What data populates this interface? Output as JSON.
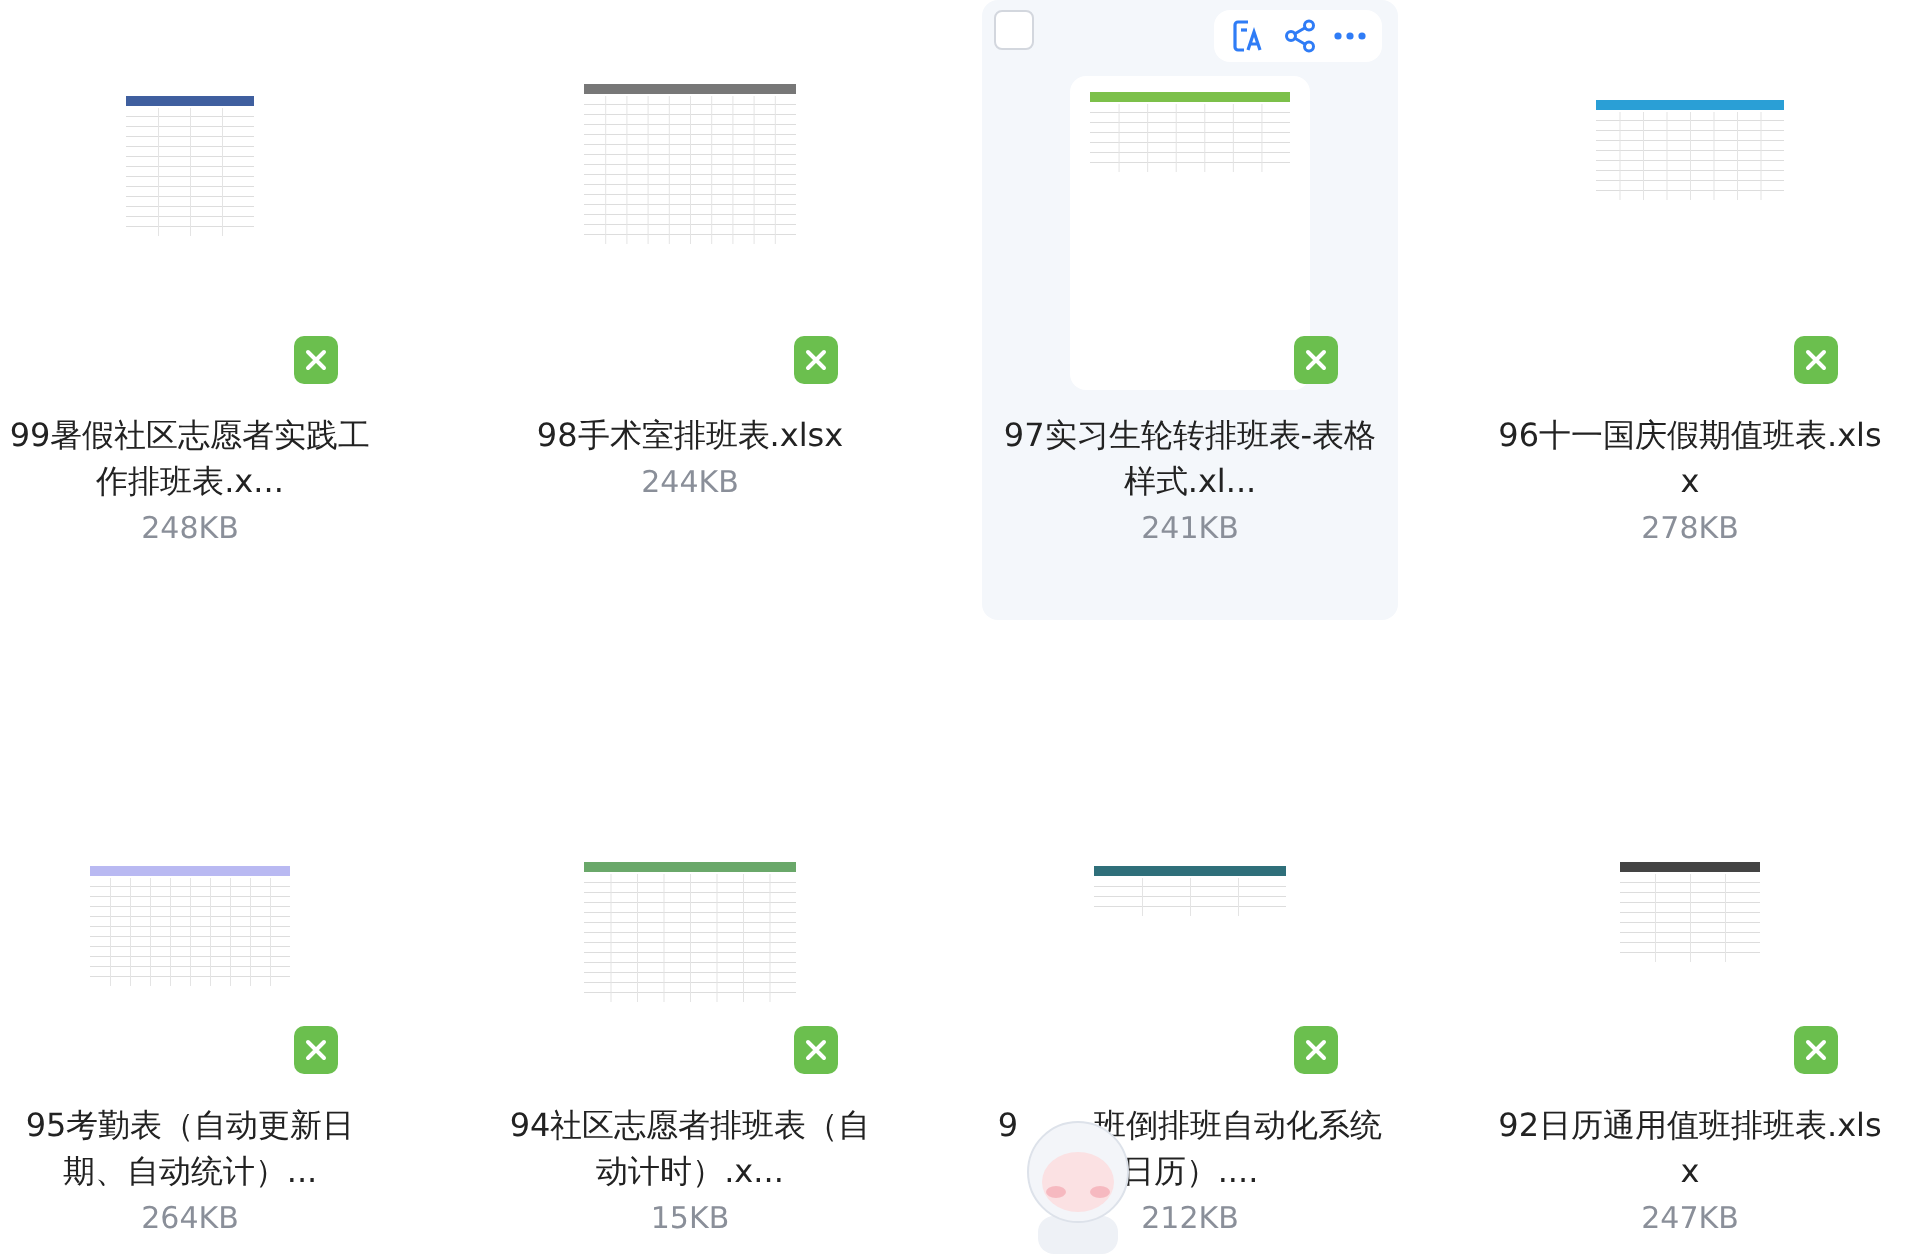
{
  "files": [
    {
      "title_lines": [
        [
          "99暑假社区志愿者实践工"
        ],
        [
          "作排班表.x..."
        ]
      ],
      "size": "248KB",
      "hovered": false
    },
    {
      "title_lines": [
        [
          "98手术室排班表.xlsx"
        ]
      ],
      "size": "244KB",
      "hovered": false
    },
    {
      "title_lines": [
        [
          "97实习生轮转排班表-表格"
        ],
        [
          "样式.xl..."
        ]
      ],
      "size": "241KB",
      "hovered": true,
      "checked": false
    },
    {
      "title_lines": [
        [
          "96十一国庆假期值班表.xls"
        ],
        [
          "x"
        ]
      ],
      "size": "278KB",
      "hovered": false
    },
    {
      "title_lines": [
        [
          "95考勤表（自动更新日"
        ],
        [
          "期、自动统计）..."
        ]
      ],
      "size": "264KB",
      "hovered": false
    },
    {
      "title_lines": [
        [
          "94社区志愿者排班表（自"
        ],
        [
          "动计时）.x..."
        ]
      ],
      "size": "15KB",
      "hovered": false
    },
    {
      "title_lines": [
        [
          "9",
          "班倒排班自动化系统"
        ],
        [
          "日历）...."
        ]
      ],
      "size": "212KB",
      "hovered": false
    },
    {
      "title_lines": [
        [
          "92日历通用值班排班表.xls"
        ],
        [
          "x"
        ]
      ],
      "size": "247KB",
      "hovered": false
    }
  ]
}
